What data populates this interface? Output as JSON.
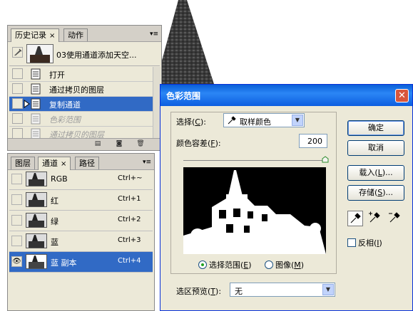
{
  "history_panel": {
    "tabs": [
      "历史记录",
      "动作"
    ],
    "close_glyph": "×",
    "snapshot_label": "03使用通道添加天空...",
    "items": [
      {
        "label": "打开",
        "state": "normal"
      },
      {
        "label": "通过拷贝的图层",
        "state": "normal"
      },
      {
        "label": "复制通道",
        "state": "selected"
      },
      {
        "label": "色彩范围",
        "state": "dimmed"
      },
      {
        "label": "通过拷贝的图层",
        "state": "dimmed"
      }
    ]
  },
  "channels_panel": {
    "tabs": [
      "图层",
      "通道",
      "路径"
    ],
    "close_glyph": "×",
    "channels": [
      {
        "name": "RGB",
        "shortcut": "Ctrl+~",
        "visible": false
      },
      {
        "name": "红",
        "shortcut": "Ctrl+1",
        "visible": false
      },
      {
        "name": "绿",
        "shortcut": "Ctrl+2",
        "visible": false
      },
      {
        "name": "蓝",
        "shortcut": "Ctrl+3",
        "visible": false
      },
      {
        "name": "蓝 副本",
        "shortcut": "Ctrl+4",
        "visible": true,
        "selected": true
      }
    ]
  },
  "dialog": {
    "title": "色彩范围",
    "close_glyph": "✕",
    "select_label": "选择(",
    "select_key": "C",
    "select_suffix": "):",
    "select_value": "取样颜色",
    "fuzziness_label": "颜色容差(",
    "fuzziness_key": "F",
    "fuzziness_suffix": "):",
    "fuzziness_value": "200",
    "fuzziness_slider": 1.0,
    "radio_selection": "选择范围(",
    "radio_selection_key": "E",
    "radio_image": "图像(",
    "radio_image_key": "M",
    "radio_suffix": ")",
    "preview_label": "选区预览(",
    "preview_key": "T",
    "preview_suffix": "):",
    "preview_value": "无",
    "buttons": {
      "ok": "确定",
      "cancel": "取消",
      "load_prefix": "载入(",
      "load_key": "L",
      "load_suffix": ")...",
      "save_prefix": "存储(",
      "save_key": "S",
      "save_suffix": ")..."
    },
    "invert_label": "反相(",
    "invert_key": "I",
    "invert_suffix": ")"
  },
  "colors": {
    "selection_blue": "#316ac5",
    "panel_bg": "#ece9d8",
    "title_blue": "#0a5fd8"
  }
}
